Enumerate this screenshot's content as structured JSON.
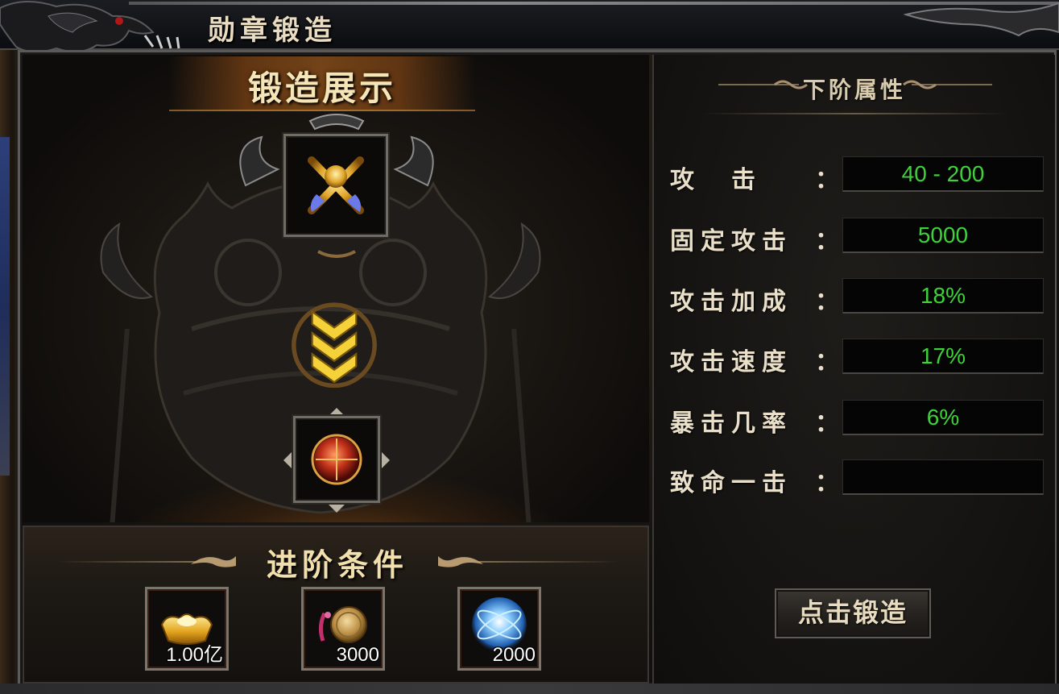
{
  "window": {
    "title": "勋章锻造"
  },
  "display": {
    "title": "锻造展示"
  },
  "conditions": {
    "title": "进阶条件",
    "items": [
      {
        "icon": "gold-ingot-icon",
        "quantity": "1.00亿"
      },
      {
        "icon": "medal-token-icon",
        "quantity": "3000"
      },
      {
        "icon": "energy-orb-icon",
        "quantity": "2000"
      }
    ]
  },
  "attributes": {
    "title": "下阶属性",
    "rows": [
      {
        "label": "攻　击",
        "colon": "：",
        "value": "40 - 200"
      },
      {
        "label": "固定攻击",
        "colon": "：",
        "value": "5000"
      },
      {
        "label": "攻击加成",
        "colon": "：",
        "value": "18%"
      },
      {
        "label": "攻击速度",
        "colon": "：",
        "value": "17%"
      },
      {
        "label": "暴击几率",
        "colon": "：",
        "value": "6%"
      },
      {
        "label": "致命一击",
        "colon": "：",
        "value": ""
      }
    ]
  },
  "forge_button": {
    "label": "点击锻造"
  },
  "colors": {
    "value_green": "#3fd23a",
    "gold_text": "#f2dfae"
  }
}
